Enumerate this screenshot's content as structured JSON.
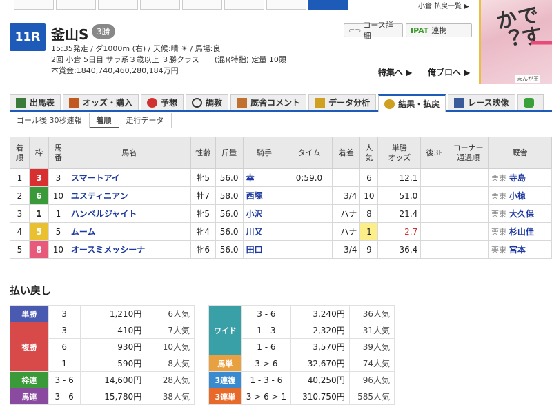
{
  "top": {
    "right_text": "小倉 払戻一覧 ▶"
  },
  "ad": {
    "big_text": "ですか？",
    "footer": "まんが王"
  },
  "race": {
    "number": "11R",
    "name": "釜山S",
    "grade": "3勝",
    "line1": "15:35発走 / ダ1000m (右) / 天候:晴 ☀ / 馬場:良",
    "line2": "2回 小倉 5日目 サラ系３歳以上 ３勝クラス　　(混)(特指) 定量 10頭",
    "line3": "本賞金:1840,740,460,280,184万円"
  },
  "buttons": {
    "course": "コース詳細",
    "ipat_logo": "IPAT",
    "ipat": "連携"
  },
  "links": {
    "feature": "特集へ ▶",
    "pro": "俺プロへ ▶"
  },
  "tabs": [
    {
      "label": "出馬表",
      "color": "#3a7a3a"
    },
    {
      "label": "オッズ・購入",
      "color": "#c05a20"
    },
    {
      "label": "予想",
      "color": "#d03030"
    },
    {
      "label": "調教",
      "color": "#333333"
    },
    {
      "label": "厩舎コメント",
      "color": "#c07030"
    },
    {
      "label": "データ分析",
      "color": "#d0a020"
    },
    {
      "label": "結果・払戻",
      "color": "#d0a020"
    },
    {
      "label": "レース映像",
      "color": "#3a5a9a"
    },
    {
      "label": "",
      "color": "#3aa03a"
    }
  ],
  "subtabs": [
    "ゴール後 30秒速報",
    "着順",
    "走行データ"
  ],
  "results": {
    "headers": [
      "着\n順",
      "枠",
      "馬\n番",
      "馬名",
      "性齢",
      "斤量",
      "騎手",
      "タイム",
      "着差",
      "人\n気",
      "単勝\nオッズ",
      "後3F",
      "コーナー\n通過順",
      "厩舎"
    ],
    "rows": [
      {
        "rank": "1",
        "waku": "3",
        "waku_color": "#d83030",
        "num": "3",
        "horse": "スマートアイ",
        "sex": "牝5",
        "weight": "56.0",
        "jockey": "幸",
        "time": "0:59.0",
        "margin": "",
        "pop": "6",
        "odds": "12.1",
        "l3f": "",
        "corner": "",
        "tr_area": "栗東",
        "trainer": "寺島",
        "fav": false
      },
      {
        "rank": "2",
        "waku": "6",
        "waku_color": "#3a9a3a",
        "num": "10",
        "horse": "ユスティニアン",
        "sex": "牡7",
        "weight": "58.0",
        "jockey": "西塚",
        "time": "",
        "margin": "3/4",
        "pop": "10",
        "odds": "51.0",
        "l3f": "",
        "corner": "",
        "tr_area": "栗東",
        "trainer": "小椋",
        "fav": false
      },
      {
        "rank": "3",
        "waku": "1",
        "waku_color": "#ffffff",
        "num": "1",
        "horse": "ハンベルジャイト",
        "sex": "牝5",
        "weight": "56.0",
        "jockey": "小沢",
        "time": "",
        "margin": "ハナ",
        "pop": "8",
        "odds": "21.4",
        "l3f": "",
        "corner": "",
        "tr_area": "栗東",
        "trainer": "大久保",
        "fav": false
      },
      {
        "rank": "4",
        "waku": "5",
        "waku_color": "#e8c030",
        "num": "5",
        "horse": "ムーム",
        "sex": "牝4",
        "weight": "56.0",
        "jockey": "川又",
        "time": "",
        "margin": "ハナ",
        "pop": "1",
        "odds": "2.7",
        "l3f": "",
        "corner": "",
        "tr_area": "栗東",
        "trainer": "杉山佳",
        "fav": true
      },
      {
        "rank": "5",
        "waku": "8",
        "waku_color": "#e85a7a",
        "num": "10",
        "horse": "オースミメッシーナ",
        "sex": "牝6",
        "weight": "56.0",
        "jockey": "田口",
        "time": "",
        "margin": "3/4",
        "pop": "9",
        "odds": "36.4",
        "l3f": "",
        "corner": "",
        "tr_area": "栗東",
        "trainer": "宮本",
        "fav": false
      }
    ]
  },
  "payout_title": "払い戻し",
  "payout_left": [
    {
      "label": "単勝",
      "color": "#4a5ab0",
      "rows": [
        {
          "combo": "3",
          "amount": "1,210円",
          "pop": "6人気"
        }
      ]
    },
    {
      "label": "複勝",
      "color": "#d84a4a",
      "rows": [
        {
          "combo": "3",
          "amount": "410円",
          "pop": "7人気"
        },
        {
          "combo": "6",
          "amount": "930円",
          "pop": "10人気"
        },
        {
          "combo": "1",
          "amount": "590円",
          "pop": "8人気"
        }
      ]
    },
    {
      "label": "枠連",
      "color": "#3a9a3a",
      "rows": [
        {
          "combo": "3 - 6",
          "amount": "14,600円",
          "pop": "28人気"
        }
      ]
    },
    {
      "label": "馬連",
      "color": "#8a4aa0",
      "rows": [
        {
          "combo": "3 - 6",
          "amount": "15,780円",
          "pop": "38人気"
        }
      ]
    }
  ],
  "payout_right": [
    {
      "label": "ワイド",
      "color": "#3aa0a8",
      "rows": [
        {
          "combo": "3 - 6",
          "amount": "3,240円",
          "pop": "36人気"
        },
        {
          "combo": "1 - 3",
          "amount": "2,320円",
          "pop": "31人気"
        },
        {
          "combo": "1 - 6",
          "amount": "3,570円",
          "pop": "39人気"
        }
      ]
    },
    {
      "label": "馬単",
      "color": "#e8a040",
      "rows": [
        {
          "combo": "3 > 6",
          "amount": "32,670円",
          "pop": "74人気"
        }
      ]
    },
    {
      "label": "3連複",
      "color": "#3a8ad0",
      "rows": [
        {
          "combo": "1 - 3 - 6",
          "amount": "40,250円",
          "pop": "96人気"
        }
      ]
    },
    {
      "label": "3連単",
      "color": "#e86a2a",
      "rows": [
        {
          "combo": "3 > 6 > 1",
          "amount": "310,750円",
          "pop": "585人気"
        }
      ]
    }
  ]
}
